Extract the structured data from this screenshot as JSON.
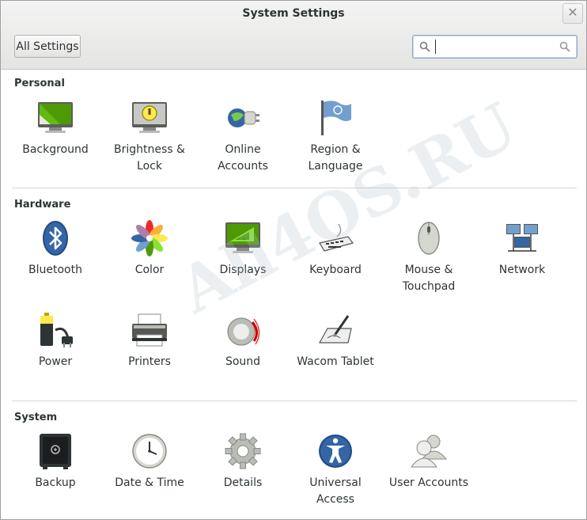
{
  "window": {
    "title": "System Settings"
  },
  "toolbar": {
    "all_settings_label": "All Settings",
    "search_placeholder": "",
    "search_value": ""
  },
  "sections": {
    "personal": {
      "title": "Personal",
      "items": [
        {
          "label_line1": "Background",
          "label_line2": "",
          "icon": "background-icon"
        },
        {
          "label_line1": "Brightness &",
          "label_line2": "Lock",
          "icon": "brightness-lock-icon"
        },
        {
          "label_line1": "Online",
          "label_line2": "Accounts",
          "icon": "online-accounts-icon"
        },
        {
          "label_line1": "Region &",
          "label_line2": "Language",
          "icon": "region-flag-icon"
        }
      ]
    },
    "hardware": {
      "title": "Hardware",
      "items": [
        {
          "label_line1": "Bluetooth",
          "label_line2": "",
          "icon": "bluetooth-icon"
        },
        {
          "label_line1": "Color",
          "label_line2": "",
          "icon": "color-icon"
        },
        {
          "label_line1": "Displays",
          "label_line2": "",
          "icon": "display-icon"
        },
        {
          "label_line1": "Keyboard",
          "label_line2": "",
          "icon": "keyboard-icon"
        },
        {
          "label_line1": "Mouse &",
          "label_line2": "Touchpad",
          "icon": "mouse-icon"
        },
        {
          "label_line1": "Network",
          "label_line2": "",
          "icon": "network-icon"
        },
        {
          "label_line1": "Power",
          "label_line2": "",
          "icon": "battery-plug-icon"
        },
        {
          "label_line1": "Printers",
          "label_line2": "",
          "icon": "printer-icon"
        },
        {
          "label_line1": "Sound",
          "label_line2": "",
          "icon": "speaker-icon"
        },
        {
          "label_line1": "Wacom Tablet",
          "label_line2": "",
          "icon": "tablet-pen-icon"
        }
      ]
    },
    "system": {
      "title": "System",
      "items": [
        {
          "label_line1": "Backup",
          "label_line2": "",
          "icon": "safe-icon"
        },
        {
          "label_line1": "Date & Time",
          "label_line2": "",
          "icon": "clock-icon"
        },
        {
          "label_line1": "Details",
          "label_line2": "",
          "icon": "gear-icon"
        },
        {
          "label_line1": "Universal",
          "label_line2": "Access",
          "icon": "accessibility-icon"
        },
        {
          "label_line1": "User Accounts",
          "label_line2": "",
          "icon": "users-icon"
        }
      ]
    }
  },
  "watermark": {
    "text": "All4OS.RU"
  },
  "colors": {
    "accent": "#3465a4",
    "separator": "#d6d6d3"
  }
}
